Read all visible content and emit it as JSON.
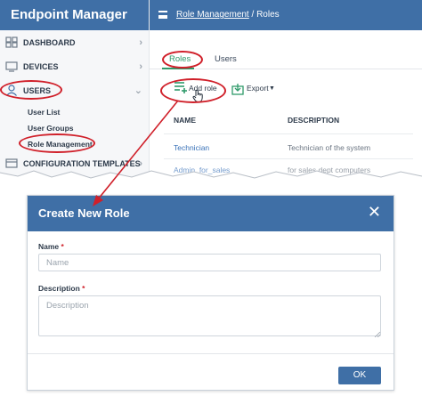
{
  "app": {
    "title": "Endpoint Manager"
  },
  "header": {
    "breadcrumb_link": "Role Management",
    "breadcrumb_separator": "/",
    "breadcrumb_current": "Roles"
  },
  "sidebar": {
    "items": [
      {
        "label": "DASHBOARD",
        "icon": "dashboard-icon"
      },
      {
        "label": "DEVICES",
        "icon": "devices-icon"
      },
      {
        "label": "USERS",
        "icon": "user-icon"
      },
      {
        "label": "CONFIGURATION TEMPLATES",
        "icon": "templates-icon"
      }
    ],
    "users_sub": [
      "User List",
      "User Groups",
      "Role Management"
    ]
  },
  "tabs": [
    "Roles",
    "Users"
  ],
  "toolbar": {
    "add_role": "Add role",
    "export": "Export"
  },
  "table": {
    "headers": [
      "NAME",
      "DESCRIPTION"
    ],
    "rows": [
      {
        "name": "Technician",
        "description": "Technician of the system"
      },
      {
        "name": "Admin_for_sales",
        "description": "for sales dept computers"
      }
    ]
  },
  "modal": {
    "title": "Create New Role",
    "close": "✕",
    "name_label": "Name",
    "name_placeholder": "Name",
    "description_label": "Description",
    "description_placeholder": "Description",
    "required_mark": "*",
    "ok_label": "OK"
  },
  "colors": {
    "brand": "#3f6fa6",
    "active_tab": "#2f9a6a",
    "highlight": "#d0202a",
    "link": "#3a72b8"
  }
}
